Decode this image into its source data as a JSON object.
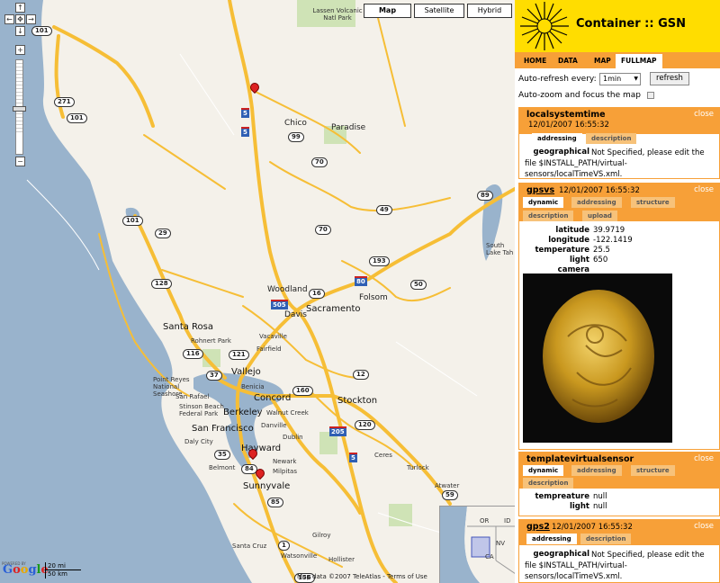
{
  "map": {
    "types": {
      "map": "Map",
      "satellite": "Satellite",
      "hybrid": "Hybrid"
    },
    "zoom": {
      "in": "+",
      "out": "−"
    },
    "nav": {
      "up": "↑",
      "left": "←",
      "center": "✥",
      "right": "→",
      "down": "↓"
    },
    "scale": {
      "mi": "20 mi",
      "km": "50 km"
    },
    "copyright": "Map data ©2007 TeleAtlas - Terms of Use",
    "logo": "Google",
    "powered": "POWERED BY",
    "cities": {
      "lassen": "Lassen Volcanic Natl Park",
      "chico": "Chico",
      "paradise": "Paradise",
      "woodland": "Woodland",
      "davis": "Davis",
      "sacramento": "Sacramento",
      "folsom": "Folsom",
      "santarosa": "Santa Rosa",
      "rohnert": "Rohnert Park",
      "vacaville": "Vacaville",
      "fairfield": "Fairfield",
      "vallejo": "Vallejo",
      "benicia": "Benicia",
      "concord": "Concord",
      "pointreyes": "Point Reyes National Seashore",
      "sanrafael": "San Rafael",
      "stinson": "Stinson Beach",
      "federalpark": "Federal Park",
      "berkeley": "Berkeley",
      "walnutcreek": "Walnut Creek",
      "danville": "Danville",
      "stockton": "Stockton",
      "sanfrancisco": "San Francisco",
      "dalycity": "Daly City",
      "dublin": "Dublin",
      "hayward": "Hayward",
      "newark": "Newark",
      "belmont": "Belmont",
      "milpitas": "Milpitas",
      "sunnyvale": "Sunnyvale",
      "ceres": "Ceres",
      "turlock": "Turlock",
      "atwater": "Atwater",
      "gilroy": "Gilroy",
      "santacruz": "Santa Cruz",
      "watsonville": "Watsonville",
      "hollister": "Hollister",
      "southlake": "South Lake Tah"
    },
    "overview": {
      "or": "OR",
      "id": "ID",
      "nv": "NV",
      "ca": "CA"
    }
  },
  "panel": {
    "title": "Container :: GSN",
    "tabs": [
      "HOME",
      "DATA",
      "MAP",
      "FULLMAP"
    ],
    "active_tab": "FULLMAP",
    "autorefresh_label": "Auto-refresh every:",
    "autorefresh_value": "1min",
    "refresh_button": "refresh",
    "autozoom_label": "Auto-zoom and focus the map",
    "close": "close",
    "sensors": [
      {
        "name": "localsystemtime",
        "time": "12/01/2007 16:55:32",
        "tabs": [
          "addressing",
          "description"
        ],
        "active": "addressing",
        "field": "geographical",
        "value": "Not Specified, please edit the file $INSTALL_PATH/virtual-sensors/localTimeVS.xml."
      },
      {
        "name": "gpsvs",
        "time": "12/01/2007 16:55:32",
        "tabs": [
          "dynamic",
          "addressing",
          "structure",
          "description",
          "upload"
        ],
        "active": "dynamic",
        "rows": [
          {
            "k": "latitude",
            "v": "39.9719"
          },
          {
            "k": "longitude",
            "v": "-122.1419"
          },
          {
            "k": "temperature",
            "v": "25.5"
          },
          {
            "k": "light",
            "v": "650"
          },
          {
            "k": "camera",
            "v": ""
          }
        ]
      },
      {
        "name": "templatevirtualsensor",
        "time": "",
        "tabs": [
          "dynamic",
          "addressing",
          "structure",
          "description"
        ],
        "active": "dynamic",
        "rows": [
          {
            "k": "tempreature",
            "v": "null"
          },
          {
            "k": "light",
            "v": "null"
          }
        ]
      },
      {
        "name": "gps2",
        "time": "12/01/2007 16:55:32",
        "tabs": [
          "addressing",
          "description"
        ],
        "active": "addressing",
        "field": "geographical",
        "value": "Not Specified, please edit the file $INSTALL_PATH/virtual-sensors/localTimeVS.xml."
      }
    ]
  },
  "colors": {
    "accent": "#f7a038",
    "header": "#ffdd00",
    "water": "#99b3cc",
    "land": "#f4f1ea",
    "highway": "#f6be36",
    "pin": "#dd2222"
  }
}
